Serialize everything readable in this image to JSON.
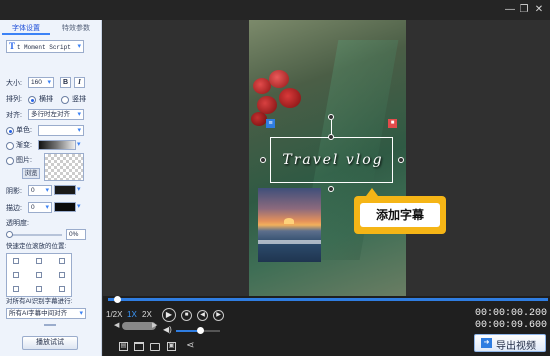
{
  "colors": {
    "accent": "#3b82f6",
    "panel_bg": "#eef3fb",
    "workspace_bg": "#303030",
    "callout_yellow": "#f5b516",
    "selection_border": "#ffffff"
  },
  "window": {
    "controls": [
      "minimize-icon",
      "restore-icon",
      "close-icon"
    ]
  },
  "left_panel": {
    "tabs": [
      {
        "label": "字体设置",
        "active": true
      },
      {
        "label": "特效参数",
        "active": false
      }
    ],
    "font_select": {
      "glyph": "T",
      "value": "t Moment Script"
    },
    "size": {
      "label": "大小:",
      "value": "160",
      "bold": "B",
      "italic": "I"
    },
    "arrangement": {
      "label": "排列:",
      "options": [
        {
          "label": "横排",
          "selected": true
        },
        {
          "label": "竖排",
          "selected": false
        }
      ]
    },
    "align": {
      "label": "对齐:",
      "value": "多行时左对齐"
    },
    "fill": {
      "solid_label": "单色:",
      "gradient_label": "渐变:",
      "image_label": "图片:",
      "browse_label": "浏览",
      "selected": "solid"
    },
    "shadow": {
      "label": "阴影:",
      "value": "0"
    },
    "stroke": {
      "label": "描边:",
      "value": "0"
    },
    "opacity": {
      "label": "透明度:",
      "value": "0%",
      "level": 0
    },
    "quick_position_label": "快速定位滚放的位置:",
    "ai_subtitle": {
      "label": "对所有AI识别字幕进行:",
      "value": "所有AI字幕中间对齐"
    },
    "play_button": "播放试试"
  },
  "canvas": {
    "subtitle_text": "Travel vlog",
    "callout_text": "添加字幕"
  },
  "timeline": {
    "speeds": [
      {
        "label": "1/2X",
        "active": false
      },
      {
        "label": "1X",
        "active": true
      },
      {
        "label": "2X",
        "active": false
      }
    ],
    "current_time": "00:00:00.200",
    "total_time": "00:00:09.600",
    "export_label": "导出视频",
    "progress": 0.02,
    "volume": 0.55
  }
}
